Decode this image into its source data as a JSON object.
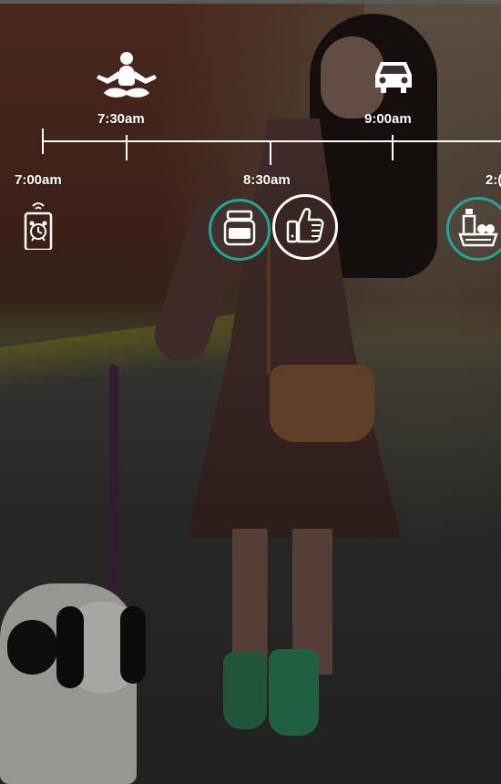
{
  "timeline": {
    "labels": {
      "t0700": "7:00am",
      "t0730": "7:30am",
      "t0830": "8:30am",
      "t0900": "9:00am",
      "t_partial": "2:("
    },
    "line_color": "#ffffff",
    "accent_color": "#1aa99a"
  },
  "icons": {
    "meditation": "meditation-icon",
    "car": "car-icon",
    "alarm_phone": "alarm-phone-icon",
    "jar": "jar-icon",
    "thumbs_up": "thumbs-up-icon",
    "groceries": "groceries-icon"
  }
}
